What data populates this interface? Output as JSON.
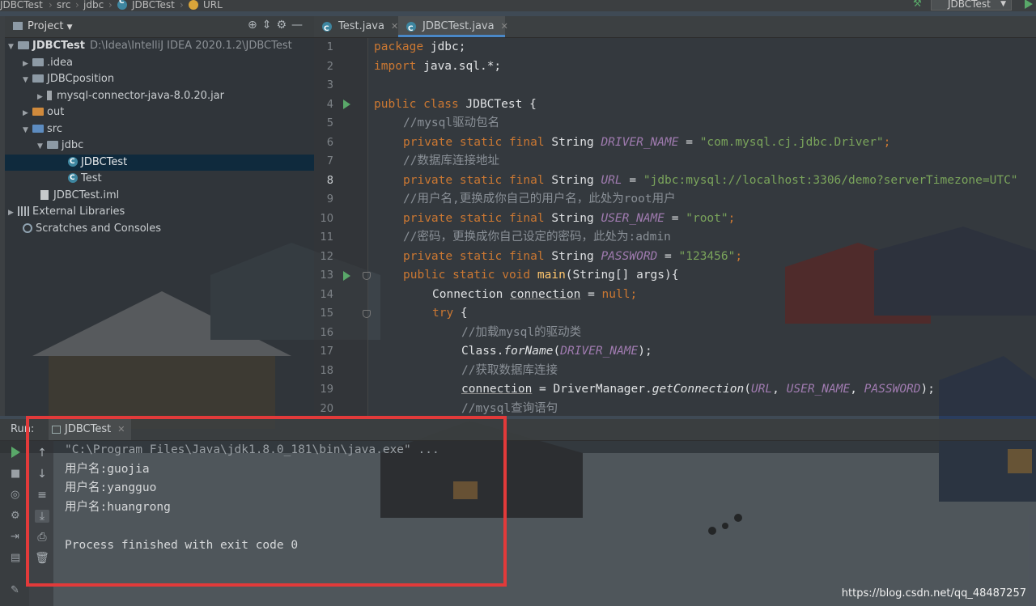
{
  "breadcrumb": {
    "items": [
      "JDBCTest",
      "src",
      "jdbc",
      "JDBCTest",
      "URL"
    ]
  },
  "run_config": {
    "label": "JDBCTest"
  },
  "project_panel": {
    "title": "Project",
    "tree": [
      {
        "label": "JDBCTest",
        "path": "D:\\Idea\\IntelliJ IDEA 2020.1.2\\JDBCTest",
        "type": "module",
        "expanded": true
      },
      {
        "label": ".idea",
        "type": "folder"
      },
      {
        "label": "JDBCposition",
        "type": "folder",
        "expanded": true
      },
      {
        "label": "mysql-connector-java-8.0.20.jar",
        "type": "jar"
      },
      {
        "label": "out",
        "type": "folder-orange"
      },
      {
        "label": "src",
        "type": "folder-blue",
        "expanded": true
      },
      {
        "label": "jdbc",
        "type": "package",
        "expanded": true
      },
      {
        "label": "JDBCTest",
        "type": "class",
        "selected": true
      },
      {
        "label": "Test",
        "type": "class"
      },
      {
        "label": "JDBCTest.iml",
        "type": "iml"
      },
      {
        "label": "External Libraries",
        "type": "libraries"
      },
      {
        "label": "Scratches and Consoles",
        "type": "scratches"
      }
    ]
  },
  "editor": {
    "tabs": [
      {
        "label": "Test.java",
        "active": false
      },
      {
        "label": "JDBCTest.java",
        "active": true
      }
    ],
    "line_numbers": [
      "1",
      "2",
      "3",
      "4",
      "5",
      "6",
      "7",
      "8",
      "9",
      "10",
      "11",
      "12",
      "13",
      "14",
      "15",
      "16",
      "17",
      "18",
      "19",
      "20"
    ],
    "current_line": "8",
    "code": {
      "l1a": "package",
      "l1b": " jdbc;",
      "l2a": "import",
      "l2b": " java.sql.*;",
      "l4a": "public class",
      "l4b": " JDBCTest {",
      "l5": "//mysql驱动包名",
      "l6a": "private static final",
      "l6b": " String ",
      "l6c": "DRIVER_NAME",
      "l6d": " = ",
      "l6e": "\"com.mysql.cj.jdbc.Driver\"",
      "l6f": ";",
      "l7": "//数据库连接地址",
      "l8a": "private static final",
      "l8b": " String ",
      "l8c": "URL",
      "l8d": " = ",
      "l8e": "\"jdbc:mysql://localhost:3306/demo?serverTimezone=UTC\"",
      "l9": "//用户名,更换成你自己的用户名，此处为root用户",
      "l10a": "private static final",
      "l10b": " String ",
      "l10c": "USER_NAME",
      "l10d": " = ",
      "l10e": "\"root\"",
      "l10f": ";",
      "l11": "//密码，更换成你自己设定的密码，此处为:admin",
      "l12a": "private static final",
      "l12b": " String ",
      "l12c": "PASSWORD",
      "l12d": " = ",
      "l12e": "\"123456\"",
      "l12f": ";",
      "l13a": "public static void",
      "l13b": " ",
      "l13c": "main",
      "l13d": "(String[] args){",
      "l14a": "Connection ",
      "l14b": "connection",
      "l14c": " = ",
      "l14d": "null",
      "l14e": ";",
      "l15a": "try",
      "l15b": " {",
      "l16": "//加载mysql的驱动类",
      "l17a": "Class.",
      "l17b": "forName",
      "l17c": "(",
      "l17d": "DRIVER_NAME",
      "l17e": ");",
      "l18": "//获取数据库连接",
      "l19a": "connection",
      "l19b": " = DriverManager.",
      "l19c": "getConnection",
      "l19d": "(",
      "l19e": "URL",
      "l19f": ", ",
      "l19g": "USER_NAME",
      "l19h": ", ",
      "l19i": "PASSWORD",
      "l19j": ");",
      "l20": "//mysql查询语句"
    }
  },
  "run_panel": {
    "label": "Run:",
    "tab": "JDBCTest",
    "output": [
      "\"C:\\Program Files\\Java\\jdk1.8.0_181\\bin\\java.exe\" ...",
      "用户名:guojia",
      "用户名:yangguo",
      "用户名:huangrong",
      "",
      "Process finished with exit code 0"
    ]
  },
  "watermark": "https://blog.csdn.net/qq_48487257",
  "colors": {
    "keyword": "#cc7832",
    "string": "#7aa45b",
    "constant": "#a07bb0",
    "highlight_box": "#e23a3a"
  }
}
